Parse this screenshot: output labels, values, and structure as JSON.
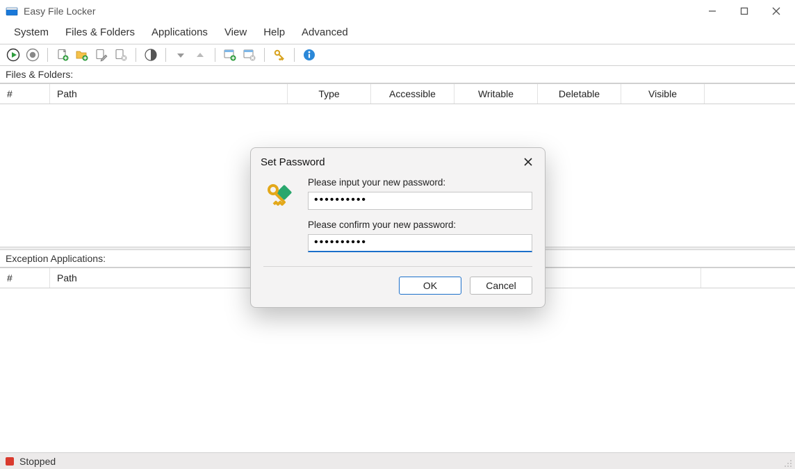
{
  "window": {
    "title": "Easy File Locker"
  },
  "menu": {
    "items": [
      "System",
      "Files & Folders",
      "Applications",
      "View",
      "Help",
      "Advanced"
    ]
  },
  "sections": {
    "files_label": "Files & Folders:",
    "exceptions_label": "Exception Applications:"
  },
  "columns_files": {
    "hash": "#",
    "path": "Path",
    "type": "Type",
    "accessible": "Accessible",
    "writable": "Writable",
    "deletable": "Deletable",
    "visible": "Visible"
  },
  "columns_exceptions": {
    "hash": "#",
    "path": "Path"
  },
  "status": {
    "text": "Stopped"
  },
  "dialog": {
    "title": "Set Password",
    "label_new": "Please input your new password:",
    "label_confirm": "Please confirm your new password:",
    "value_new": "••••••••••",
    "value_confirm": "••••••••••",
    "ok": "OK",
    "cancel": "Cancel"
  }
}
